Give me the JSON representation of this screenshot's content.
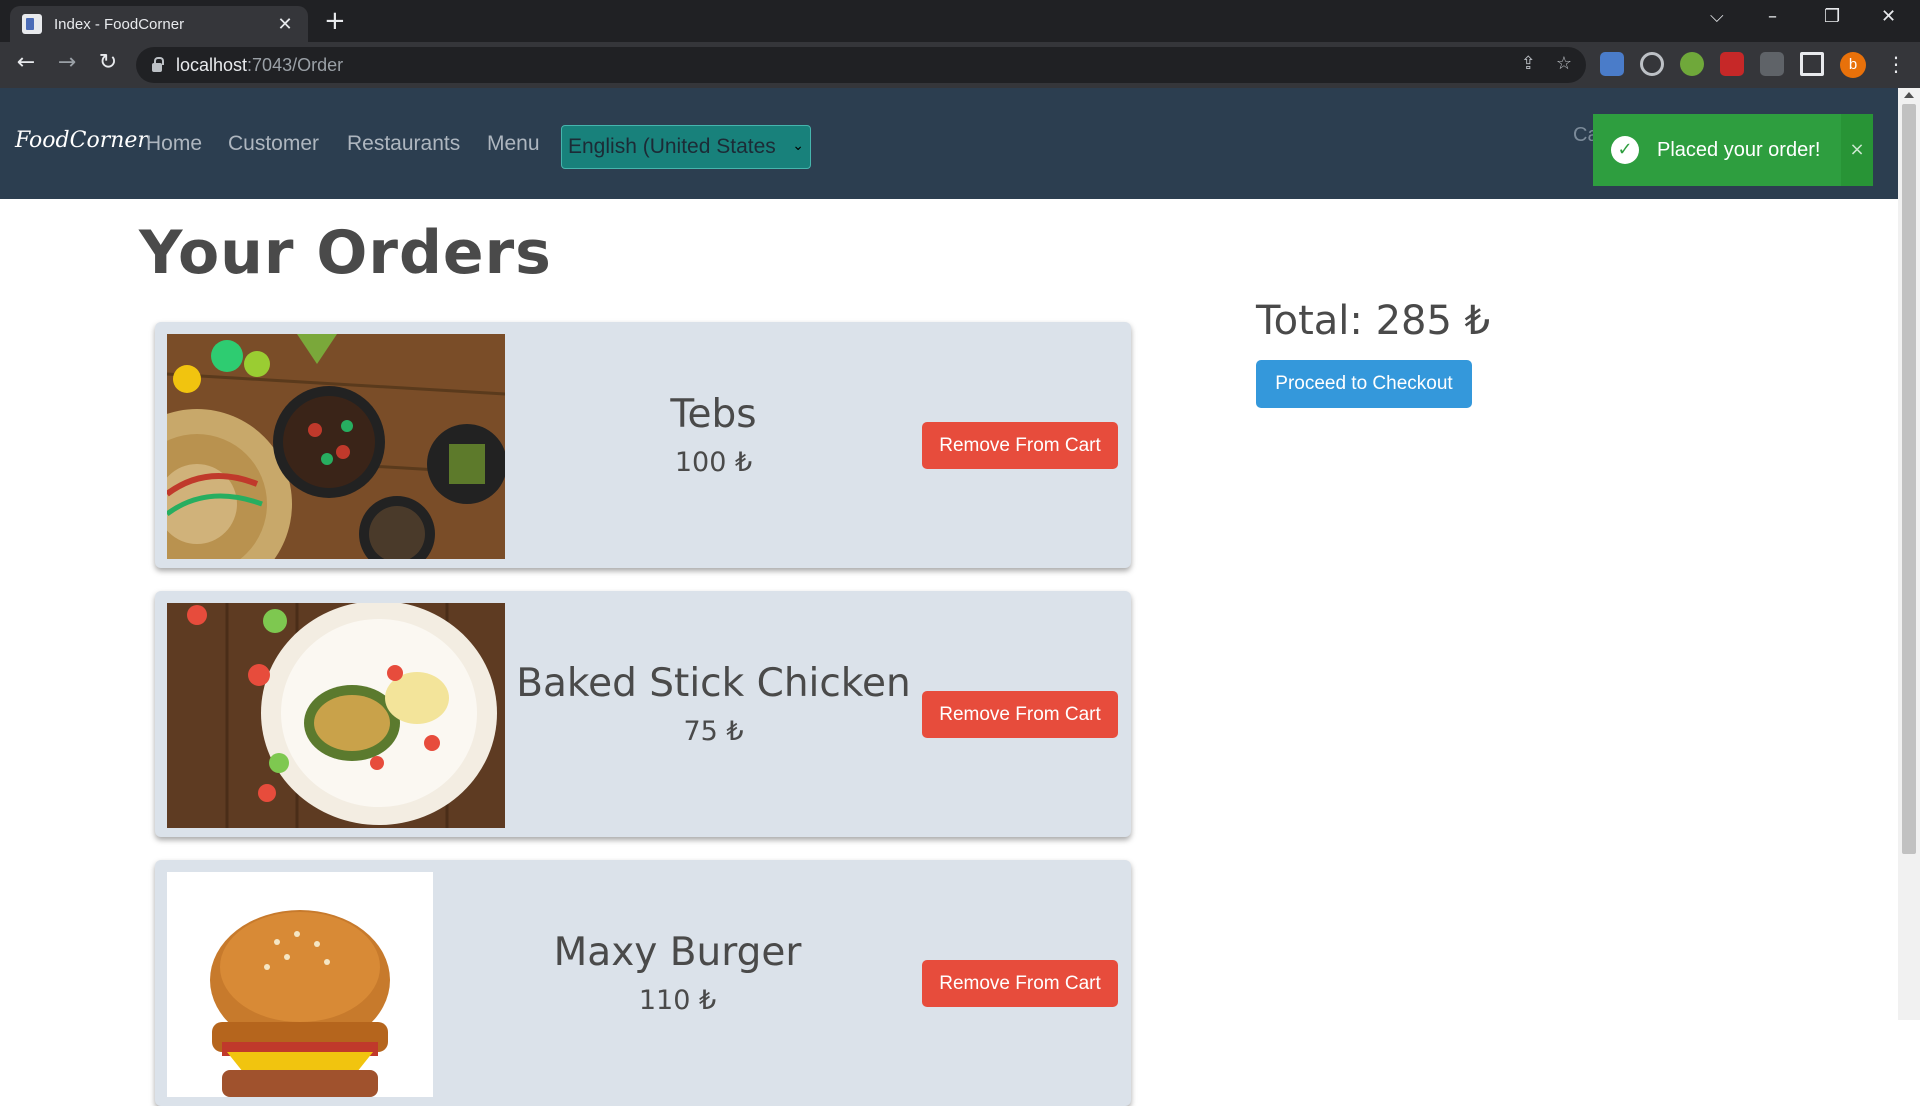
{
  "browser": {
    "tab_title": "Index - FoodCorner",
    "tab_close": "✕",
    "new_tab": "+",
    "url_host": "localhost",
    "url_path": ":7043/Order",
    "profile_initial": "b"
  },
  "navbar": {
    "brand": "FoodCorner",
    "links": [
      "Home",
      "Customer",
      "Restaurants",
      "Menu"
    ],
    "language": "English (United States",
    "cart_partial": "Ca"
  },
  "toast": {
    "message": "Placed your order!",
    "close": "×"
  },
  "page": {
    "title": "Your Orders",
    "total": "Total: 285 ₺",
    "checkout_label": "Proceed to Checkout"
  },
  "orders": [
    {
      "name": "Tebs",
      "price": "100 ₺",
      "remove_label": "Remove From Cart"
    },
    {
      "name": "Baked Stick Chicken",
      "price": "75 ₺",
      "remove_label": "Remove From Cart"
    },
    {
      "name": "Maxy Burger",
      "price": "110 ₺",
      "remove_label": "Remove From Cart"
    }
  ],
  "colors": {
    "navbar": "#2c3e50",
    "toast": "#2e9e3f",
    "checkout": "#3498db",
    "remove": "#e74c3c",
    "card": "#dbe2ea"
  }
}
